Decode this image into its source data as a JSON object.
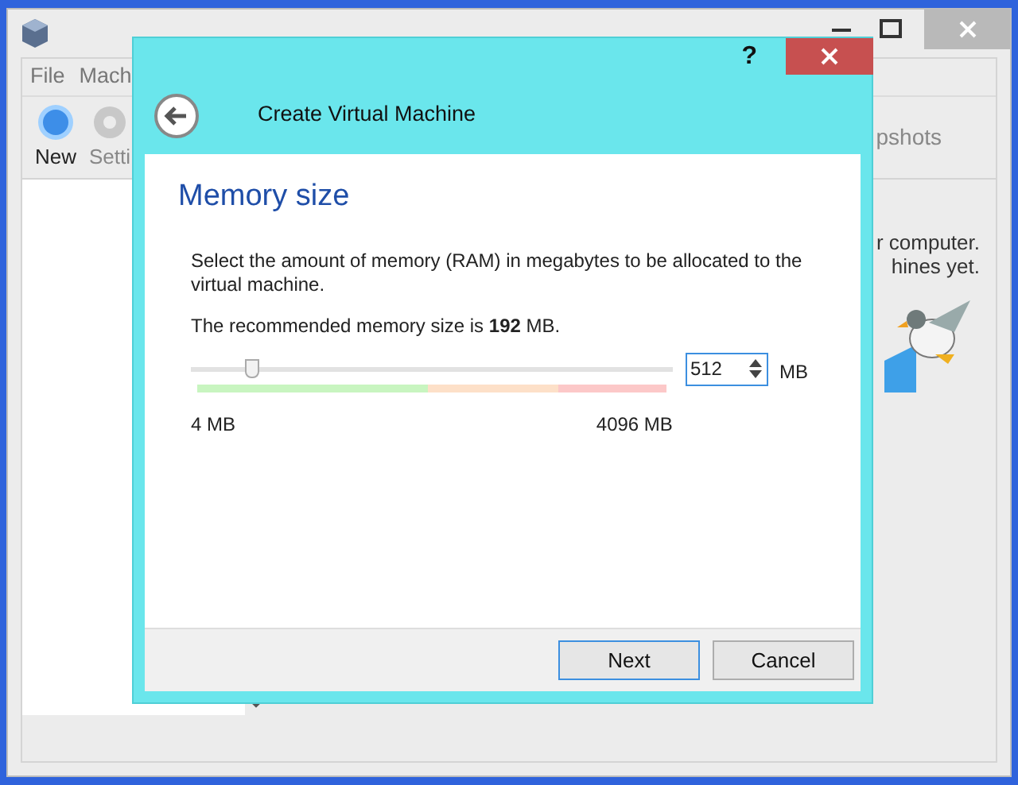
{
  "manager": {
    "menu": [
      "File",
      "Mach"
    ],
    "toolbar": [
      {
        "label": "New",
        "kind": "new"
      },
      {
        "label": "Setti",
        "kind": "settings"
      }
    ],
    "toolbar_right": "pshots",
    "welcome_lines": [
      "r computer.",
      "hines yet."
    ]
  },
  "dialog": {
    "help": "?",
    "title": "Create Virtual Machine",
    "heading": "Memory size",
    "description": "Select the amount of memory (RAM) in megabytes to be allocated to the virtual machine.",
    "recommendation": "The recommended memory size is **192** MB.",
    "slider": {
      "level": 0.125,
      "min_label": "4 MB",
      "max_label": "4096 MB"
    },
    "value": "512",
    "unit": "MB",
    "buttons": [
      {
        "label": "Next",
        "default": true
      },
      {
        "label": "Cancel",
        "default": false
      }
    ]
  }
}
